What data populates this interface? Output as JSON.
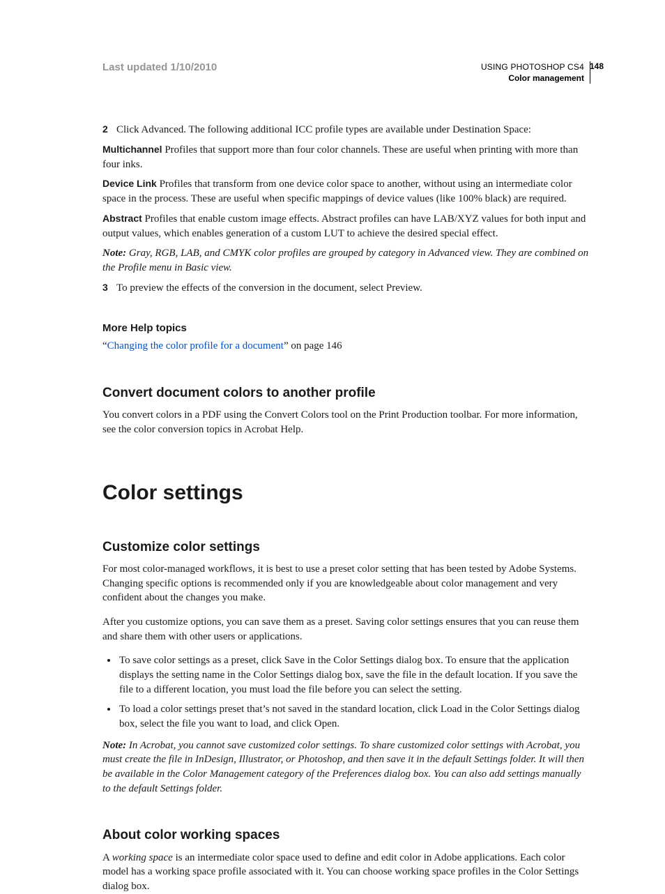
{
  "header": {
    "last_updated": "Last updated 1/10/2010",
    "book_title": "USING PHOTOSHOP CS4",
    "chapter": "Color management",
    "page_number": "148"
  },
  "step2": {
    "num": "2",
    "text": "Click Advanced. The following additional ICC profile types are available under Destination Space:"
  },
  "multichannel": {
    "term": "Multichannel",
    "text": "Profiles that support more than four color channels. These are useful when printing with more than four inks."
  },
  "devicelink": {
    "term": "Device Link",
    "text": "Profiles that transform from one device color space to another, without using an intermediate color space in the process. These are useful when specific mappings of device values (like 100% black) are required."
  },
  "abstract": {
    "term": "Abstract",
    "text": "Profiles that enable custom image effects. Abstract profiles can have LAB/XYZ values for both input and output values, which enables generation of a custom LUT to achieve the desired special effect."
  },
  "note1": {
    "label": "Note:",
    "text": "Gray, RGB, LAB, and CMYK color profiles are grouped by category in Advanced view. They are combined on the Profile menu in Basic view."
  },
  "step3": {
    "num": "3",
    "text": "To preview the effects of the conversion in the document, select Preview."
  },
  "more_help": {
    "heading": "More Help topics",
    "quote_open": "“",
    "link_text": "Changing the color profile for a document",
    "tail": "” on page 146"
  },
  "convert_h2": "Convert document colors to another profile",
  "convert_p": "You convert colors in a PDF using the Convert Colors tool on the Print Production toolbar. For more information, see the color conversion topics in Acrobat Help.",
  "color_settings_h1": "Color settings",
  "customize_h2": "Customize color settings",
  "customize_p1": "For most color-managed workflows, it is best to use a preset color setting that has been tested by Adobe Systems. Changing specific options is recommended only if you are knowledgeable about color management and very confident about the changes you make.",
  "customize_p2": "After you customize options, you can save them as a preset. Saving color settings ensures that you can reuse them and share them with other users or applications.",
  "customize_bullets": [
    "To save color settings as a preset, click Save in the Color Settings dialog box. To ensure that the application displays the setting name in the Color Settings dialog box, save the file in the default location. If you save the file to a different location, you must load the file before you can select the setting.",
    "To load a color settings preset that’s not saved in the standard location, click Load in the Color Settings dialog box, select the file you want to load, and click Open."
  ],
  "note2": {
    "label": "Note:",
    "text": "In Acrobat, you cannot save customized color settings. To share customized color settings with Acrobat, you must create the file in InDesign, Illustrator, or Photoshop, and then save it in the default Settings folder. It will then be available in the Color Management category of the Preferences dialog box. You can also add settings manually to the default Settings folder."
  },
  "about_h2": "About color working spaces",
  "about_p_pre": "A ",
  "about_p_em": "working space",
  "about_p_post": " is an intermediate color space used to define and edit color in Adobe applications. Each color model has a working space profile associated with it. You can choose working space profiles in the Color Settings dialog box."
}
